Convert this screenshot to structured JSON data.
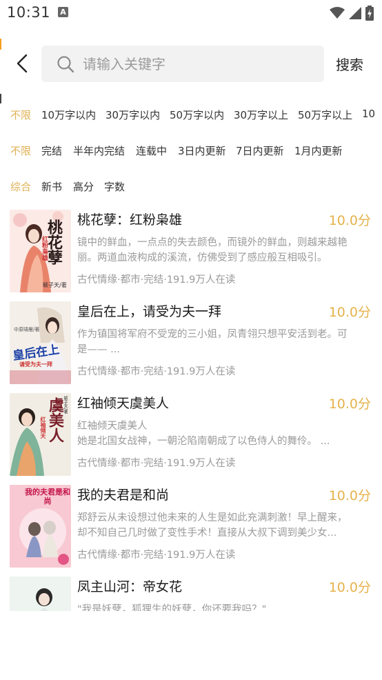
{
  "status_bar": {
    "time": "10:31",
    "notification_icon": "a-icon",
    "icons": [
      "wifi-icon",
      "signal-icon",
      "battery-charging-icon"
    ]
  },
  "search": {
    "placeholder": "请输入关键字",
    "value": "",
    "button_label": "搜索"
  },
  "filters": {
    "word_count": [
      "不限",
      "10万字以内",
      "30万字以内",
      "50万字以内",
      "30万字以上",
      "50万字以上",
      "10"
    ],
    "status": [
      "不限",
      "完结",
      "半年内完结",
      "连载中",
      "3日内更新",
      "7日内更新",
      "1月内更新"
    ],
    "sort": [
      "综合",
      "新书",
      "高分",
      "字数"
    ]
  },
  "colors": {
    "accent": "#e0b054",
    "score": "#e5b24a",
    "text_secondary": "#9a9a9a",
    "search_bg": "#f2f2f2"
  },
  "books": [
    {
      "title": "桃花孽：红粉枭雄",
      "score": "10.0分",
      "desc": "镜中的鲜血，一点点的失去颜色，而镜外的鲜血，则越来越艳丽。两道血液构成的溪流，仿佛受到了感应般互相吸引。",
      "meta": "古代情缘·都市·完结·191.9万人在读",
      "cover_text": "桃花孽",
      "cover_sub": "红粉枭雄",
      "cover_author": "颖子天/著"
    },
    {
      "title": "皇后在上，请受为夫一拜",
      "score": "10.0分",
      "desc": "作为镇国将军府不受宠的三小姐，凤青翎只想平安活到老。可是—— ...",
      "meta": "古代情缘·都市·完结·191.9万人在读",
      "cover_text": "皇后在上",
      "cover_sub": "请受为夫一拜",
      "cover_author": "中原啸雁/著"
    },
    {
      "title": "红袖倾天虞美人",
      "score": "10.0分",
      "desc": "红袖倾天虞美人\n她是北国女战神，一朝沦陷南朝成了以色侍人的舞伶。 ...",
      "meta": "古代情缘·都市·完结·191.9万人在读",
      "cover_text": "虞美人",
      "cover_sub": "红袖倾天",
      "cover_author": "颖子天/著"
    },
    {
      "title": "我的夫君是和尚",
      "score": "10.0分",
      "desc": "郑舒云从未设想过他未来的人生是如此充满刺激！早上醒来，却不知自己几时做了变性手术！直接从大叔下调到美少女...",
      "meta": "古代情缘·都市·完结·191.9万人在读",
      "cover_text": "我的夫君是和尚",
      "cover_sub": "",
      "cover_author": ""
    },
    {
      "title": "凤主山河：帝女花",
      "score": "10.0分",
      "desc": "\"我是妖孽，狐狸生的妖孽，你还要我吗？\"",
      "meta": "",
      "cover_text": "",
      "cover_sub": "",
      "cover_author": ""
    }
  ]
}
